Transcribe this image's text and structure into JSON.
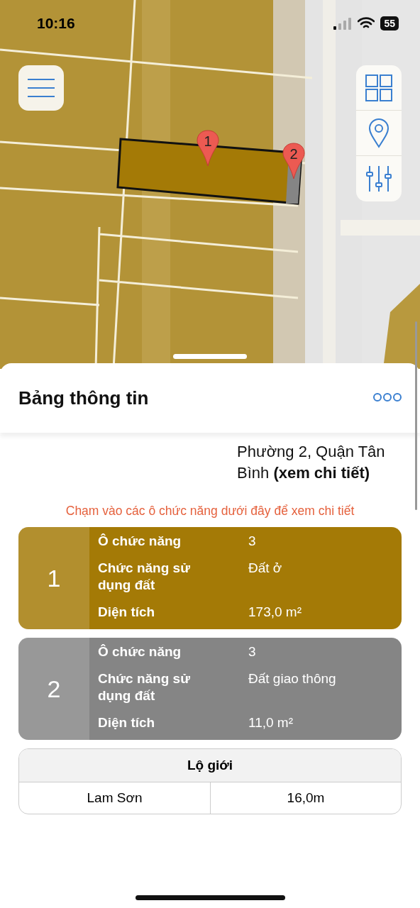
{
  "status_bar": {
    "time": "10:16",
    "battery": "55"
  },
  "map": {
    "kind": "picture",
    "markers": [
      {
        "label": "1"
      },
      {
        "label": "2"
      }
    ]
  },
  "sheet": {
    "title": "Bảng thông tin",
    "description": "Phường 2, Quận Tân Bình",
    "detail_link": "(xem chi tiết)",
    "hint": "Chạm vào các ô chức năng dưới đây để xem chi tiết",
    "parcels": [
      {
        "number": "1",
        "color": "#a47a06",
        "rows": [
          {
            "label": "Ô chức năng",
            "value": "3"
          },
          {
            "label": "Chức năng sử dụng đất",
            "value": "Đất ở"
          },
          {
            "label": "Diện tích",
            "value": "173,0 m²"
          }
        ]
      },
      {
        "number": "2",
        "color": "#858585",
        "rows": [
          {
            "label": "Ô chức năng",
            "value": "3"
          },
          {
            "label": "Chức năng sử dụng đất",
            "value": "Đất giao thông"
          },
          {
            "label": "Diện tích",
            "value": "11,0 m²"
          }
        ]
      }
    ],
    "road_width": {
      "title": "Lộ giới",
      "rows": [
        {
          "road": "Lam Sơn",
          "width": "16,0m"
        }
      ]
    }
  }
}
